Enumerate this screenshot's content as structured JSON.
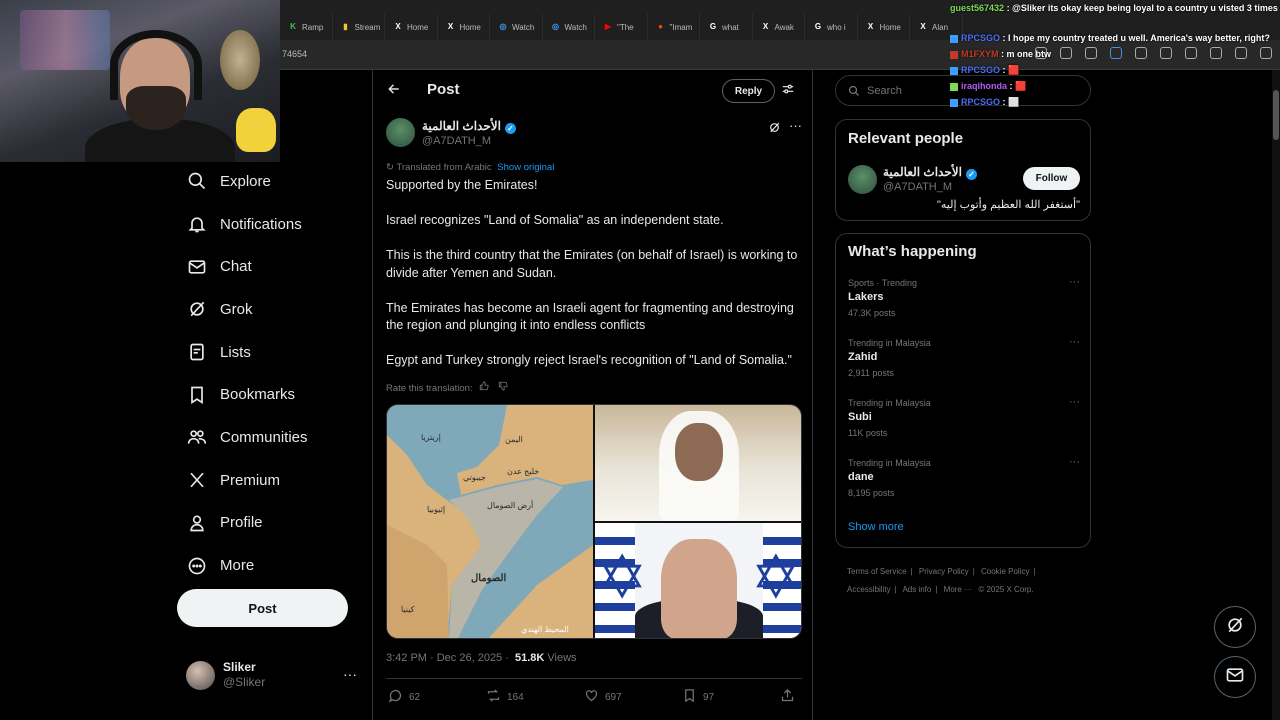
{
  "browser": {
    "tabs": [
      {
        "label": "Ramp",
        "icon": "ramp-favicon",
        "color": "#40c057"
      },
      {
        "label": "Stream",
        "icon": "chart-favicon",
        "color": "#f2c230"
      },
      {
        "label": "Home",
        "icon": "x-favicon",
        "color": "#ffffff"
      },
      {
        "label": "Home",
        "icon": "x-favicon",
        "color": "#ffffff"
      },
      {
        "label": "Watch",
        "icon": "watch-favicon",
        "color": "#3aa0ff"
      },
      {
        "label": "Watch",
        "icon": "watch-favicon",
        "color": "#3aa0ff"
      },
      {
        "label": "\"The",
        "icon": "youtube-favicon",
        "color": "#ff0000"
      },
      {
        "label": "\"Imam",
        "icon": "reddit-favicon",
        "color": "#ff4500"
      },
      {
        "label": "what",
        "icon": "google-favicon",
        "color": "#ffffff"
      },
      {
        "label": "Awak",
        "icon": "x-favicon",
        "color": "#ffffff"
      },
      {
        "label": "who i",
        "icon": "google-favicon",
        "color": "#ffffff"
      },
      {
        "label": "Home",
        "icon": "x-favicon",
        "color": "#ffffff"
      },
      {
        "label": "Alan",
        "icon": "x-favicon",
        "color": "#ffffff"
      }
    ],
    "url": "74654"
  },
  "chat": [
    {
      "user": "guest567432",
      "msg": ": @Sliker its okay keep being loyal to a country u visted 3 times in ur life",
      "color": "green"
    },
    {
      "user": "RPCSGO",
      "msg": ": I hope my country treated u well. America's way better, right?",
      "color": "blue"
    },
    {
      "user": "M1FXYM",
      "msg": ": m one btw",
      "color": "red"
    },
    {
      "user": "RPCSGO",
      "msg": ":",
      "color": "blue"
    },
    {
      "user": "iraqihonda",
      "msg": ":",
      "color": "purple"
    },
    {
      "user": "RPCSGO",
      "msg": ":",
      "color": "blue"
    }
  ],
  "nav": {
    "items": [
      {
        "label": "Explore",
        "icon": "search-icon"
      },
      {
        "label": "Notifications",
        "icon": "bell-icon"
      },
      {
        "label": "Chat",
        "icon": "mail-icon"
      },
      {
        "label": "Grok",
        "icon": "grok-icon"
      },
      {
        "label": "Lists",
        "icon": "list-icon"
      },
      {
        "label": "Bookmarks",
        "icon": "bookmark-icon"
      },
      {
        "label": "Communities",
        "icon": "people-icon"
      },
      {
        "label": "Premium",
        "icon": "x-logo-icon"
      },
      {
        "label": "Profile",
        "icon": "person-icon"
      },
      {
        "label": "More",
        "icon": "more-circle-icon"
      }
    ],
    "post_button": "Post",
    "profile": {
      "name": "Sliker",
      "handle": "@Sliker",
      "more": "···"
    }
  },
  "post": {
    "header_title": "Post",
    "reply_label": "Reply",
    "author_name": "الأحداث العالمية",
    "author_handle": "@A7DATH_M",
    "translated_label": "Translated from Arabic",
    "show_original": "Show original",
    "paragraphs": [
      "Supported by the Emirates!",
      "Israel recognizes \"Land of Somalia\" as an independent state.",
      "This is the third country that the Emirates (on behalf of Israel) is working to divide after Yemen and Sudan.",
      "The Emirates has become an Israeli agent for fragmenting and destroying the region and plunging it into endless conflicts",
      "Egypt and Turkey strongly reject Israel's recognition of \"Land of Somalia.\""
    ],
    "rate_label": "Rate this translation:",
    "map_labels": {
      "yemen": "اليمن",
      "eritrea": "إريتريا",
      "gulf": "خليج عدن",
      "djibouti": "جيبوتي",
      "somaliland": "أرض الصومال",
      "ethiopia": "إثيوبيا",
      "somalia": "الصومال",
      "kenya": "كينيا",
      "ocean": "المحيط الهندي"
    },
    "time": "3:42 PM · Dec 26, 2025 ·",
    "views_count": "51.8K",
    "views_label": "Views",
    "stats": {
      "replies": "62",
      "reposts": "164",
      "likes": "697",
      "bookmarks": "97"
    }
  },
  "right": {
    "search_placeholder": "Search",
    "relevant_title": "Relevant people",
    "relevant_person": {
      "name": "الأحداث العالمية",
      "handle": "@A7DATH_M",
      "bio": "\"أستغفر الله العظيم وأتوب إليه\"",
      "follow_label": "Follow"
    },
    "happening_title": "What’s happening",
    "trends": [
      {
        "category": "Sports · Trending",
        "name": "Lakers",
        "posts": "47.3K posts"
      },
      {
        "category": "Trending in Malaysia",
        "name": "Zahid",
        "posts": "2,911 posts"
      },
      {
        "category": "Trending in Malaysia",
        "name": "Subi",
        "posts": "11K posts"
      },
      {
        "category": "Trending in Malaysia",
        "name": "dane",
        "posts": "8,195 posts"
      }
    ],
    "show_more": "Show more",
    "footer": {
      "terms": "Terms of Service",
      "privacy": "Privacy Policy",
      "cookie": "Cookie Policy",
      "accessibility": "Accessibility",
      "ads": "Ads info",
      "more": "More ···",
      "copyright": "© 2025 X Corp."
    }
  },
  "colors": {
    "accent": "#1d9bf0",
    "background": "#000000",
    "border": "#2f3336",
    "muted": "#71767b"
  }
}
